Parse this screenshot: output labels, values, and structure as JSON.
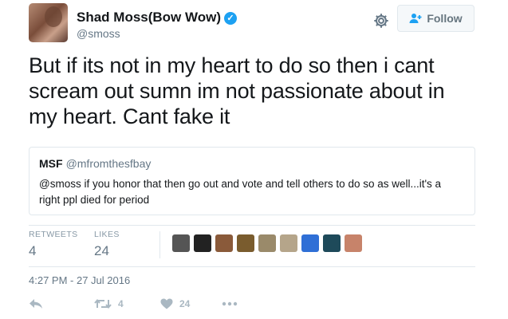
{
  "tweet": {
    "display_name": "Shad Moss(Bow Wow)",
    "verified": true,
    "handle": "@smoss",
    "follow_label": "Follow",
    "text": "But if its not in my heart to do so then i cant scream out sumn im not passionate about in my heart. Cant fake it",
    "quoted": {
      "name": "MSF",
      "handle": "@mfromthesfbay",
      "text": "@smoss if you honor that then go out and vote and tell others to do so as well...it's a right ppl died for period"
    },
    "stats": {
      "retweets_label": "RETWEETS",
      "retweets_count": "4",
      "likes_label": "LIKES",
      "likes_count": "24"
    },
    "timestamp": "4:27 PM - 27 Jul 2016",
    "actions": {
      "retweet_count": "4",
      "like_count": "24"
    },
    "liker_avatar_colors": [
      "#555555",
      "#222222",
      "#8a5a3a",
      "#7a5c2e",
      "#9a8a6a",
      "#b5a58a",
      "#2f6fd6",
      "#1e4a5a",
      "#c7836a"
    ],
    "colors": {
      "verified": "#1da1f2",
      "muted": "#657786",
      "border": "#e1e8ed"
    }
  }
}
